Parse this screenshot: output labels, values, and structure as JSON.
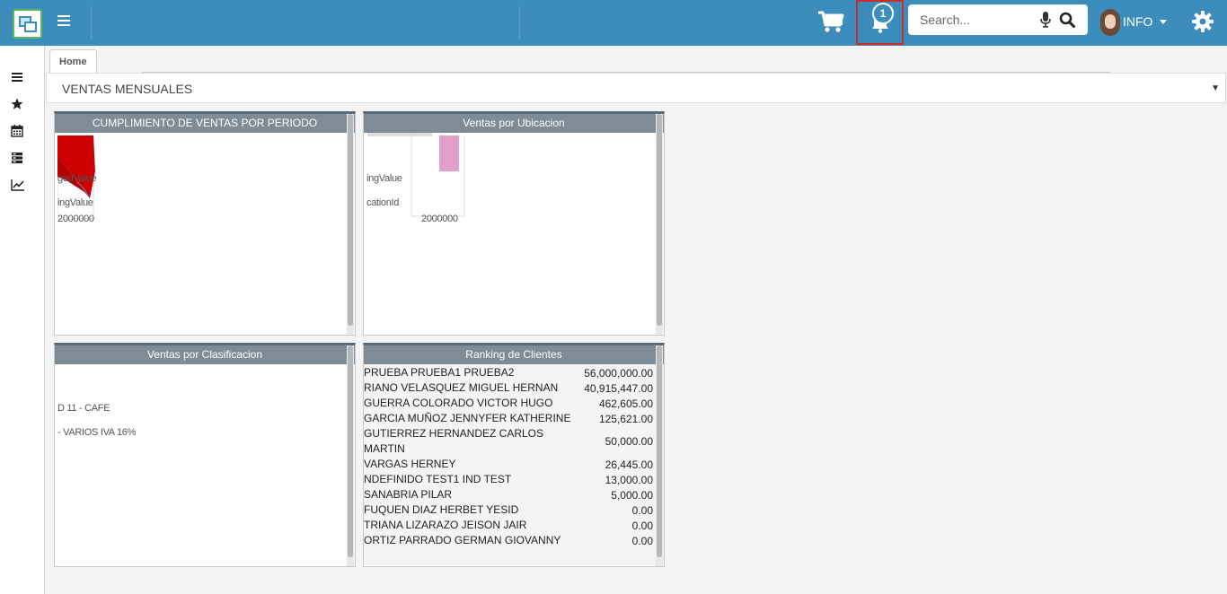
{
  "header": {
    "search_placeholder": "Search...",
    "notification_count": "1",
    "user_name": "INFO"
  },
  "tabs": [
    {
      "label": "Home"
    }
  ],
  "dashboard": {
    "selected": "VENTAS MENSUALES"
  },
  "panels": {
    "cumplimiento": {
      "title": "CUMPLIMIENTO DE VENTAS POR PERIODO",
      "fragments": [
        "gedValue",
        "ingValue",
        "2000000"
      ]
    },
    "ubicacion": {
      "title": "Ventas por Ubicacion",
      "fragments": [
        "ingValue",
        "cationId",
        "2000000"
      ]
    },
    "clasificacion": {
      "title": "Ventas por Clasificacion",
      "fragments": [
        "D 11 - CAFE",
        "- VARIOS IVA 16%"
      ]
    },
    "ranking": {
      "title": "Ranking de Clientes",
      "rows": [
        {
          "name": "PRUEBA PRUEBA1 PRUEBA2",
          "value": "56,000,000.00"
        },
        {
          "name": "RIANO VELASQUEZ MIGUEL HERNAN",
          "value": "40,915,447.00"
        },
        {
          "name": "GUERRA COLORADO VICTOR HUGO",
          "value": "462,605.00"
        },
        {
          "name": "GARCIA MUÑOZ JENNYFER KATHERINE",
          "value": "125,621.00"
        },
        {
          "name": "GUTIERREZ HERNANDEZ CARLOS MARTIN",
          "value": "50,000.00"
        },
        {
          "name": "VARGAS HERNEY",
          "value": "26,445.00"
        },
        {
          "name": "NDEFINIDO TEST1 IND TEST",
          "value": "13,000.00"
        },
        {
          "name": "SANABRIA PILAR",
          "value": "5,000.00"
        },
        {
          "name": "FUQUEN DIAZ HERBET YESID",
          "value": "0.00"
        },
        {
          "name": "TRIANA LIZARAZO JEISON JAIR",
          "value": "0.00"
        },
        {
          "name": "ORTIZ PARRADO GERMAN GIOVANNY",
          "value": "0.00"
        }
      ]
    }
  },
  "colors": {
    "header": "#3c8dbc",
    "panel_header": "#7f8c96",
    "bar_red": "#cc0000",
    "bar_pink": "#e0a0cc",
    "alert_border": "#c9302c"
  },
  "icons": [
    "menu-icon",
    "cart-icon",
    "bell-icon",
    "microphone-icon",
    "search-icon",
    "gear-icon",
    "list-icon",
    "star-icon",
    "calendar-icon",
    "server-icon",
    "line-chart-icon"
  ]
}
